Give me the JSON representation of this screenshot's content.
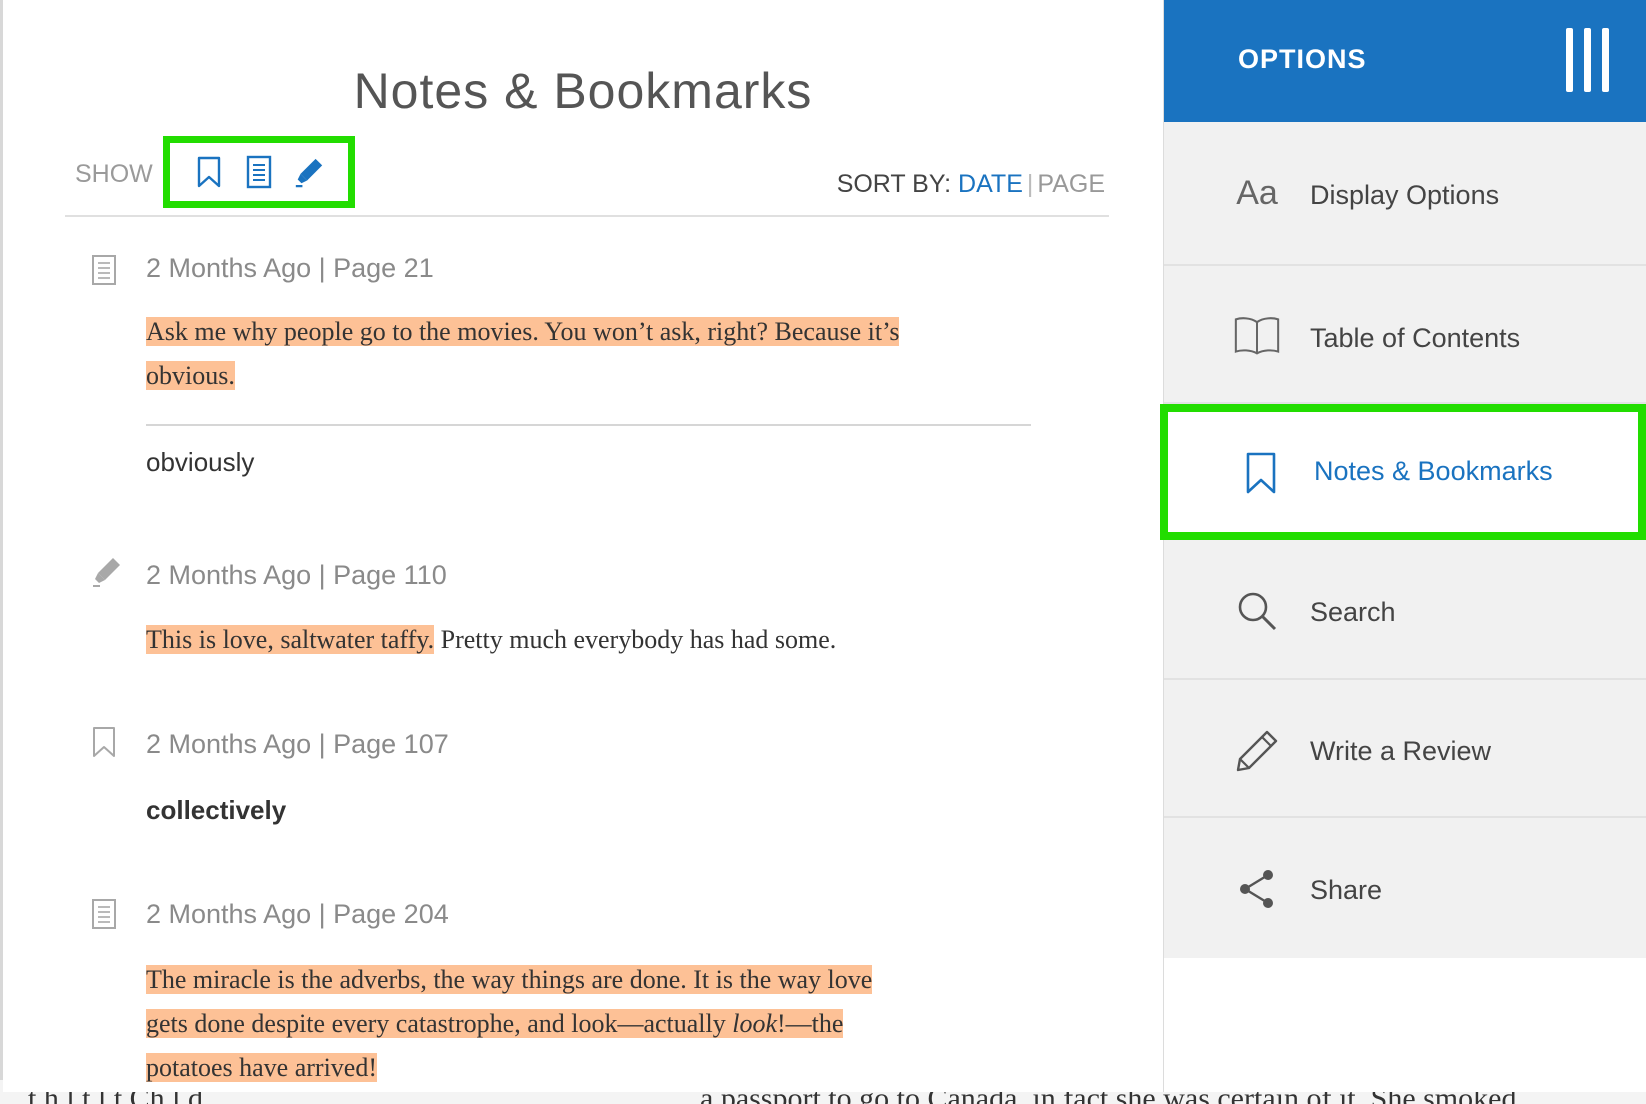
{
  "panel": {
    "title": "Notes & Bookmarks",
    "show_label": "SHOW",
    "filters": [
      {
        "icon": "bookmark-icon"
      },
      {
        "icon": "note-icon"
      },
      {
        "icon": "highlighter-icon"
      }
    ],
    "sort": {
      "label": "SORT BY:",
      "options": [
        "DATE",
        "PAGE"
      ],
      "active": "DATE",
      "separator": "|"
    }
  },
  "entries": [
    {
      "type": "note",
      "icon": "note-icon",
      "meta": "2 Months Ago | Page 21",
      "quote_lines": [
        "Ask me why people go to the movies. You won’t ask, right? Because it’s",
        "obvious."
      ],
      "note": "obviously"
    },
    {
      "type": "highlight",
      "icon": "highlighter-icon",
      "meta": "2 Months Ago | Page 110",
      "quote_highlight": "This is love, saltwater taffy.",
      "quote_rest": " Pretty much everybody has had some."
    },
    {
      "type": "bookmark",
      "icon": "bookmark-icon",
      "meta": "2 Months Ago | Page 107",
      "note": "collectively"
    },
    {
      "type": "note",
      "icon": "note-icon",
      "meta": "2 Months Ago | Page 204",
      "quote_lines": [
        "The miracle is the adverbs, the way things are done. It is the way love",
        "gets done despite every catastrophe, and look—actually ",
        "potatoes have arrived!"
      ],
      "quote_emph": "look",
      "quote_after_emph": "!—the"
    }
  ],
  "sidebar": {
    "header": "OPTIONS",
    "items": [
      {
        "label": "Display Options",
        "icon": "font-size-icon",
        "icon_text": "Aa"
      },
      {
        "label": "Table of Contents",
        "icon": "book-icon"
      },
      {
        "label": "Notes & Bookmarks",
        "icon": "bookmark-icon",
        "active": true
      },
      {
        "label": "Search",
        "icon": "search-icon"
      },
      {
        "label": "Write a Review",
        "icon": "pencil-icon"
      },
      {
        "label": "Share",
        "icon": "share-icon"
      }
    ]
  },
  "background_text": {
    "left": "t h l    t    l t   Ch     l     d",
    "right": "a passport to go to Canada, in fact she was certain of it. She smoked,"
  },
  "colors": {
    "accent": "#1a73c0",
    "highlight": "#fdc196",
    "callout": "#22dd00"
  }
}
